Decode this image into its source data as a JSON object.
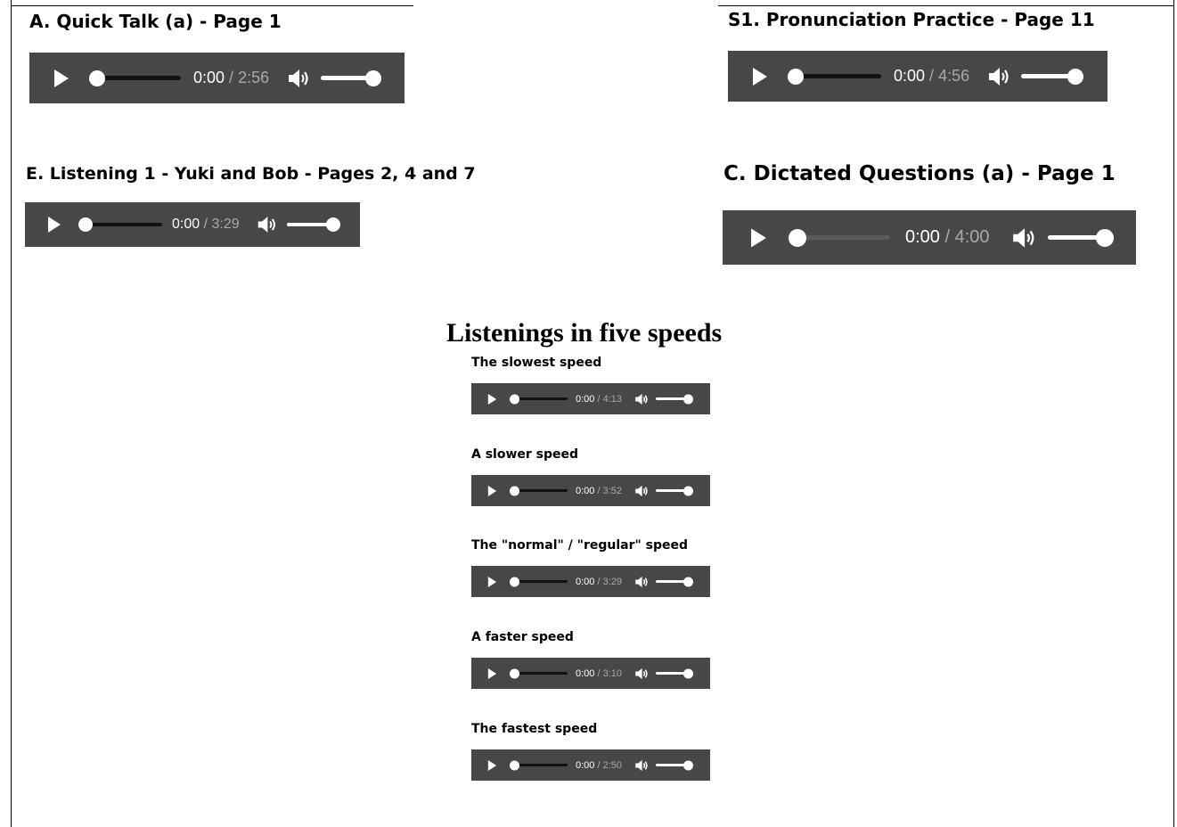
{
  "players": [
    {
      "title": "A. Quick Talk (a)  -  Page 1",
      "current": "0:00",
      "duration": "2:56",
      "volume": 1.0
    },
    {
      "title": "S1. Pronunciation Practice  -  Page 11",
      "current": "0:00",
      "duration": "4:56",
      "volume": 1.0
    },
    {
      "title": "E. Listening 1 - Yuki and Bob  -  Pages 2, 4 and 7",
      "current": "0:00",
      "duration": "3:29",
      "volume": 1.0
    },
    {
      "title": "C. Dictated Questions (a)  -  Page 1",
      "current": "0:00",
      "duration": "4:00",
      "volume": 1.0
    }
  ],
  "speeds": {
    "section_title": "Listenings in five speeds",
    "items": [
      {
        "label": "The slowest speed",
        "current": "0:00",
        "duration": "4:13"
      },
      {
        "label": "A slower speed",
        "current": "0:00",
        "duration": "3:52"
      },
      {
        "label": "The \"normal\" / \"regular\" speed",
        "current": "0:00",
        "duration": "3:29"
      },
      {
        "label": "A faster speed",
        "current": "0:00",
        "duration": "3:10"
      },
      {
        "label": "The fastest speed",
        "current": "0:00",
        "duration": "2:50"
      }
    ]
  },
  "time_separator": " / ",
  "icons": {
    "play": "play-icon",
    "volume": "volume-icon"
  },
  "colors": {
    "player_bg": "#474747",
    "duration_text": "#a9a9a9",
    "control": "#ffffff"
  }
}
